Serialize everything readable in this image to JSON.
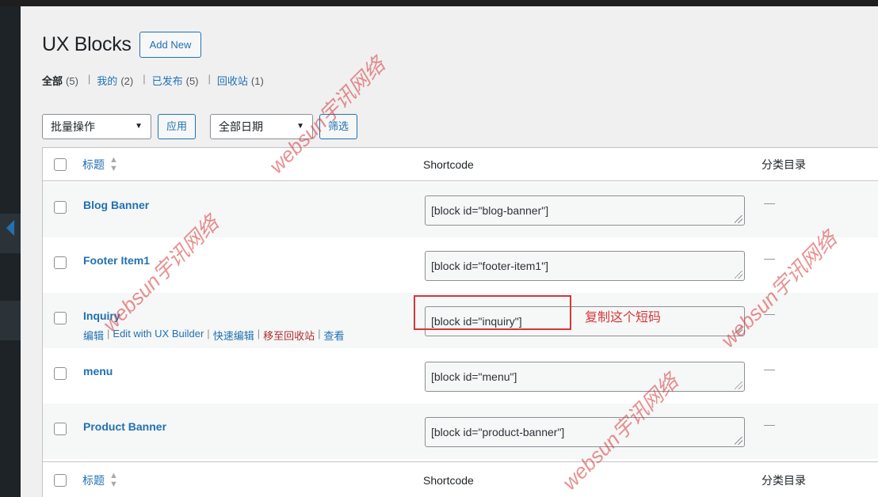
{
  "page": {
    "title": "UX Blocks",
    "add_new": "Add New"
  },
  "filters": {
    "views": [
      {
        "label": "全部",
        "count": "(5)",
        "current": true
      },
      {
        "label": "我的",
        "count": "(2)"
      },
      {
        "label": "已发布",
        "count": "(5)"
      },
      {
        "label": "回收站",
        "count": "(1)"
      }
    ]
  },
  "tablenav": {
    "bulk_select": "批量操作",
    "apply": "应用",
    "date_select": "全部日期",
    "filter": "筛选"
  },
  "table": {
    "headers": {
      "title": "标题",
      "shortcode": "Shortcode",
      "category": "分类目录"
    },
    "rows": [
      {
        "title": "Blog Banner",
        "shortcode": "[block id=\"blog-banner\"]",
        "category": "—"
      },
      {
        "title": "Footer Item1",
        "shortcode": "[block id=\"footer-item1\"]",
        "category": "—"
      },
      {
        "title": "Inquiry",
        "shortcode": "[block id=\"inquiry\"]",
        "category": "—",
        "row_actions": {
          "edit": "编辑",
          "edit_ux": "Edit with UX Builder",
          "quick_edit": "快速编辑",
          "trash": "移至回收站",
          "view": "查看"
        }
      },
      {
        "title": "menu",
        "shortcode": "[block id=\"menu\"]",
        "category": "—"
      },
      {
        "title": "Product Banner",
        "shortcode": "[block id=\"product-banner\"]",
        "category": "—"
      }
    ]
  },
  "annotation": {
    "note": "复制这个短码",
    "color": "#d63638"
  },
  "watermark": {
    "text": "websun宇讯网络"
  },
  "colors": {
    "link": "#2271b1",
    "admin_sidebar": "#1d2327",
    "trash": "#b32d2e"
  }
}
